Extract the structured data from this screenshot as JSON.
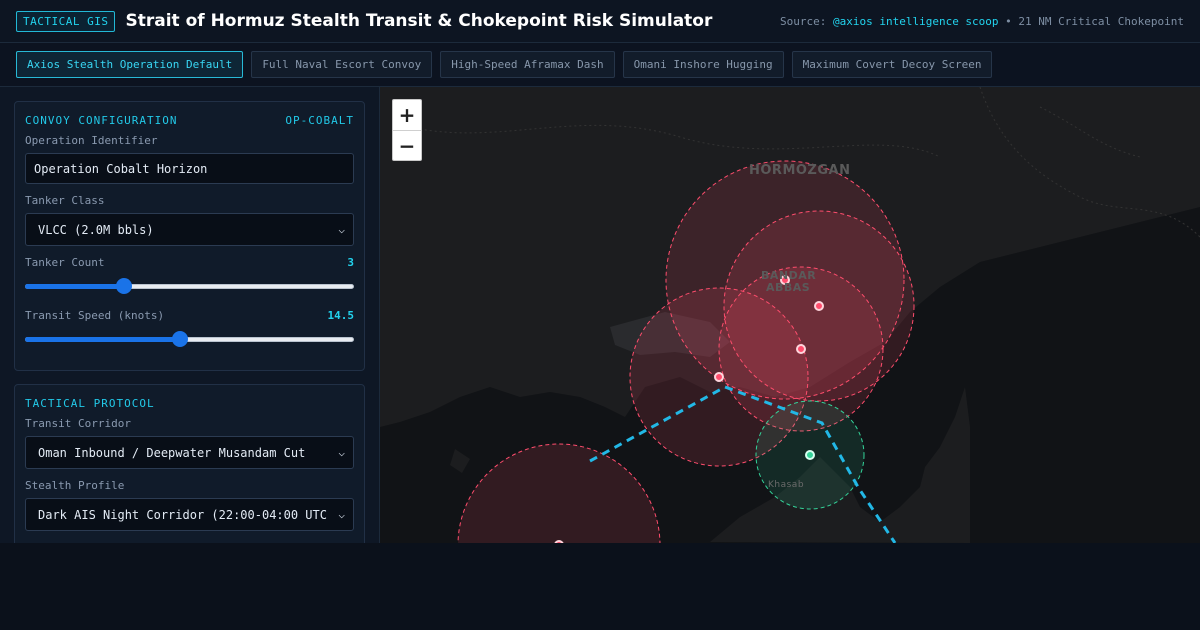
{
  "header": {
    "badge": "TACTICAL GIS",
    "title": "Strait of Hormuz Stealth Transit & Chokepoint Risk Simulator",
    "source_prefix": "Source: ",
    "source_handle": "@axios intelligence scoop",
    "source_suffix": " • 21 NM Critical Chokepoint"
  },
  "presets": [
    {
      "label": "Axios Stealth Operation Default",
      "active": true
    },
    {
      "label": "Full Naval Escort Convoy",
      "active": false
    },
    {
      "label": "High-Speed Aframax Dash",
      "active": false
    },
    {
      "label": "Omani Inshore Hugging",
      "active": false
    },
    {
      "label": "Maximum Covert Decoy Screen",
      "active": false
    }
  ],
  "convoy": {
    "heading": "CONVOY CONFIGURATION",
    "code": "OP-COBALT",
    "op_id_label": "Operation Identifier",
    "op_id_value": "Operation Cobalt Horizon",
    "tanker_class_label": "Tanker Class",
    "tanker_class_value": "VLCC (2.0M bbls)",
    "tanker_count_label": "Tanker Count",
    "tanker_count_value": "3",
    "tanker_count_fraction": 0.3,
    "speed_label": "Transit Speed (knots)",
    "speed_value": "14.5",
    "speed_fraction": 0.47
  },
  "protocol": {
    "heading": "TACTICAL PROTOCOL",
    "corridor_label": "Transit Corridor",
    "corridor_value": "Oman Inbound / Deepwater Musandam Cut",
    "stealth_label": "Stealth Profile",
    "stealth_value": "Dark AIS Night Corridor (22:00-04:00 UTC)"
  },
  "map": {
    "zoom_in": "+",
    "zoom_out": "−",
    "places": {
      "hormozgan": "HORMOZGAN",
      "bandar_1": "BANDAR",
      "bandar_2": "ABBAS",
      "khasab": "Khasab"
    },
    "colors": {
      "threat": "#ff4d6d",
      "safe": "#34d399",
      "route": "#22b8e6"
    }
  }
}
